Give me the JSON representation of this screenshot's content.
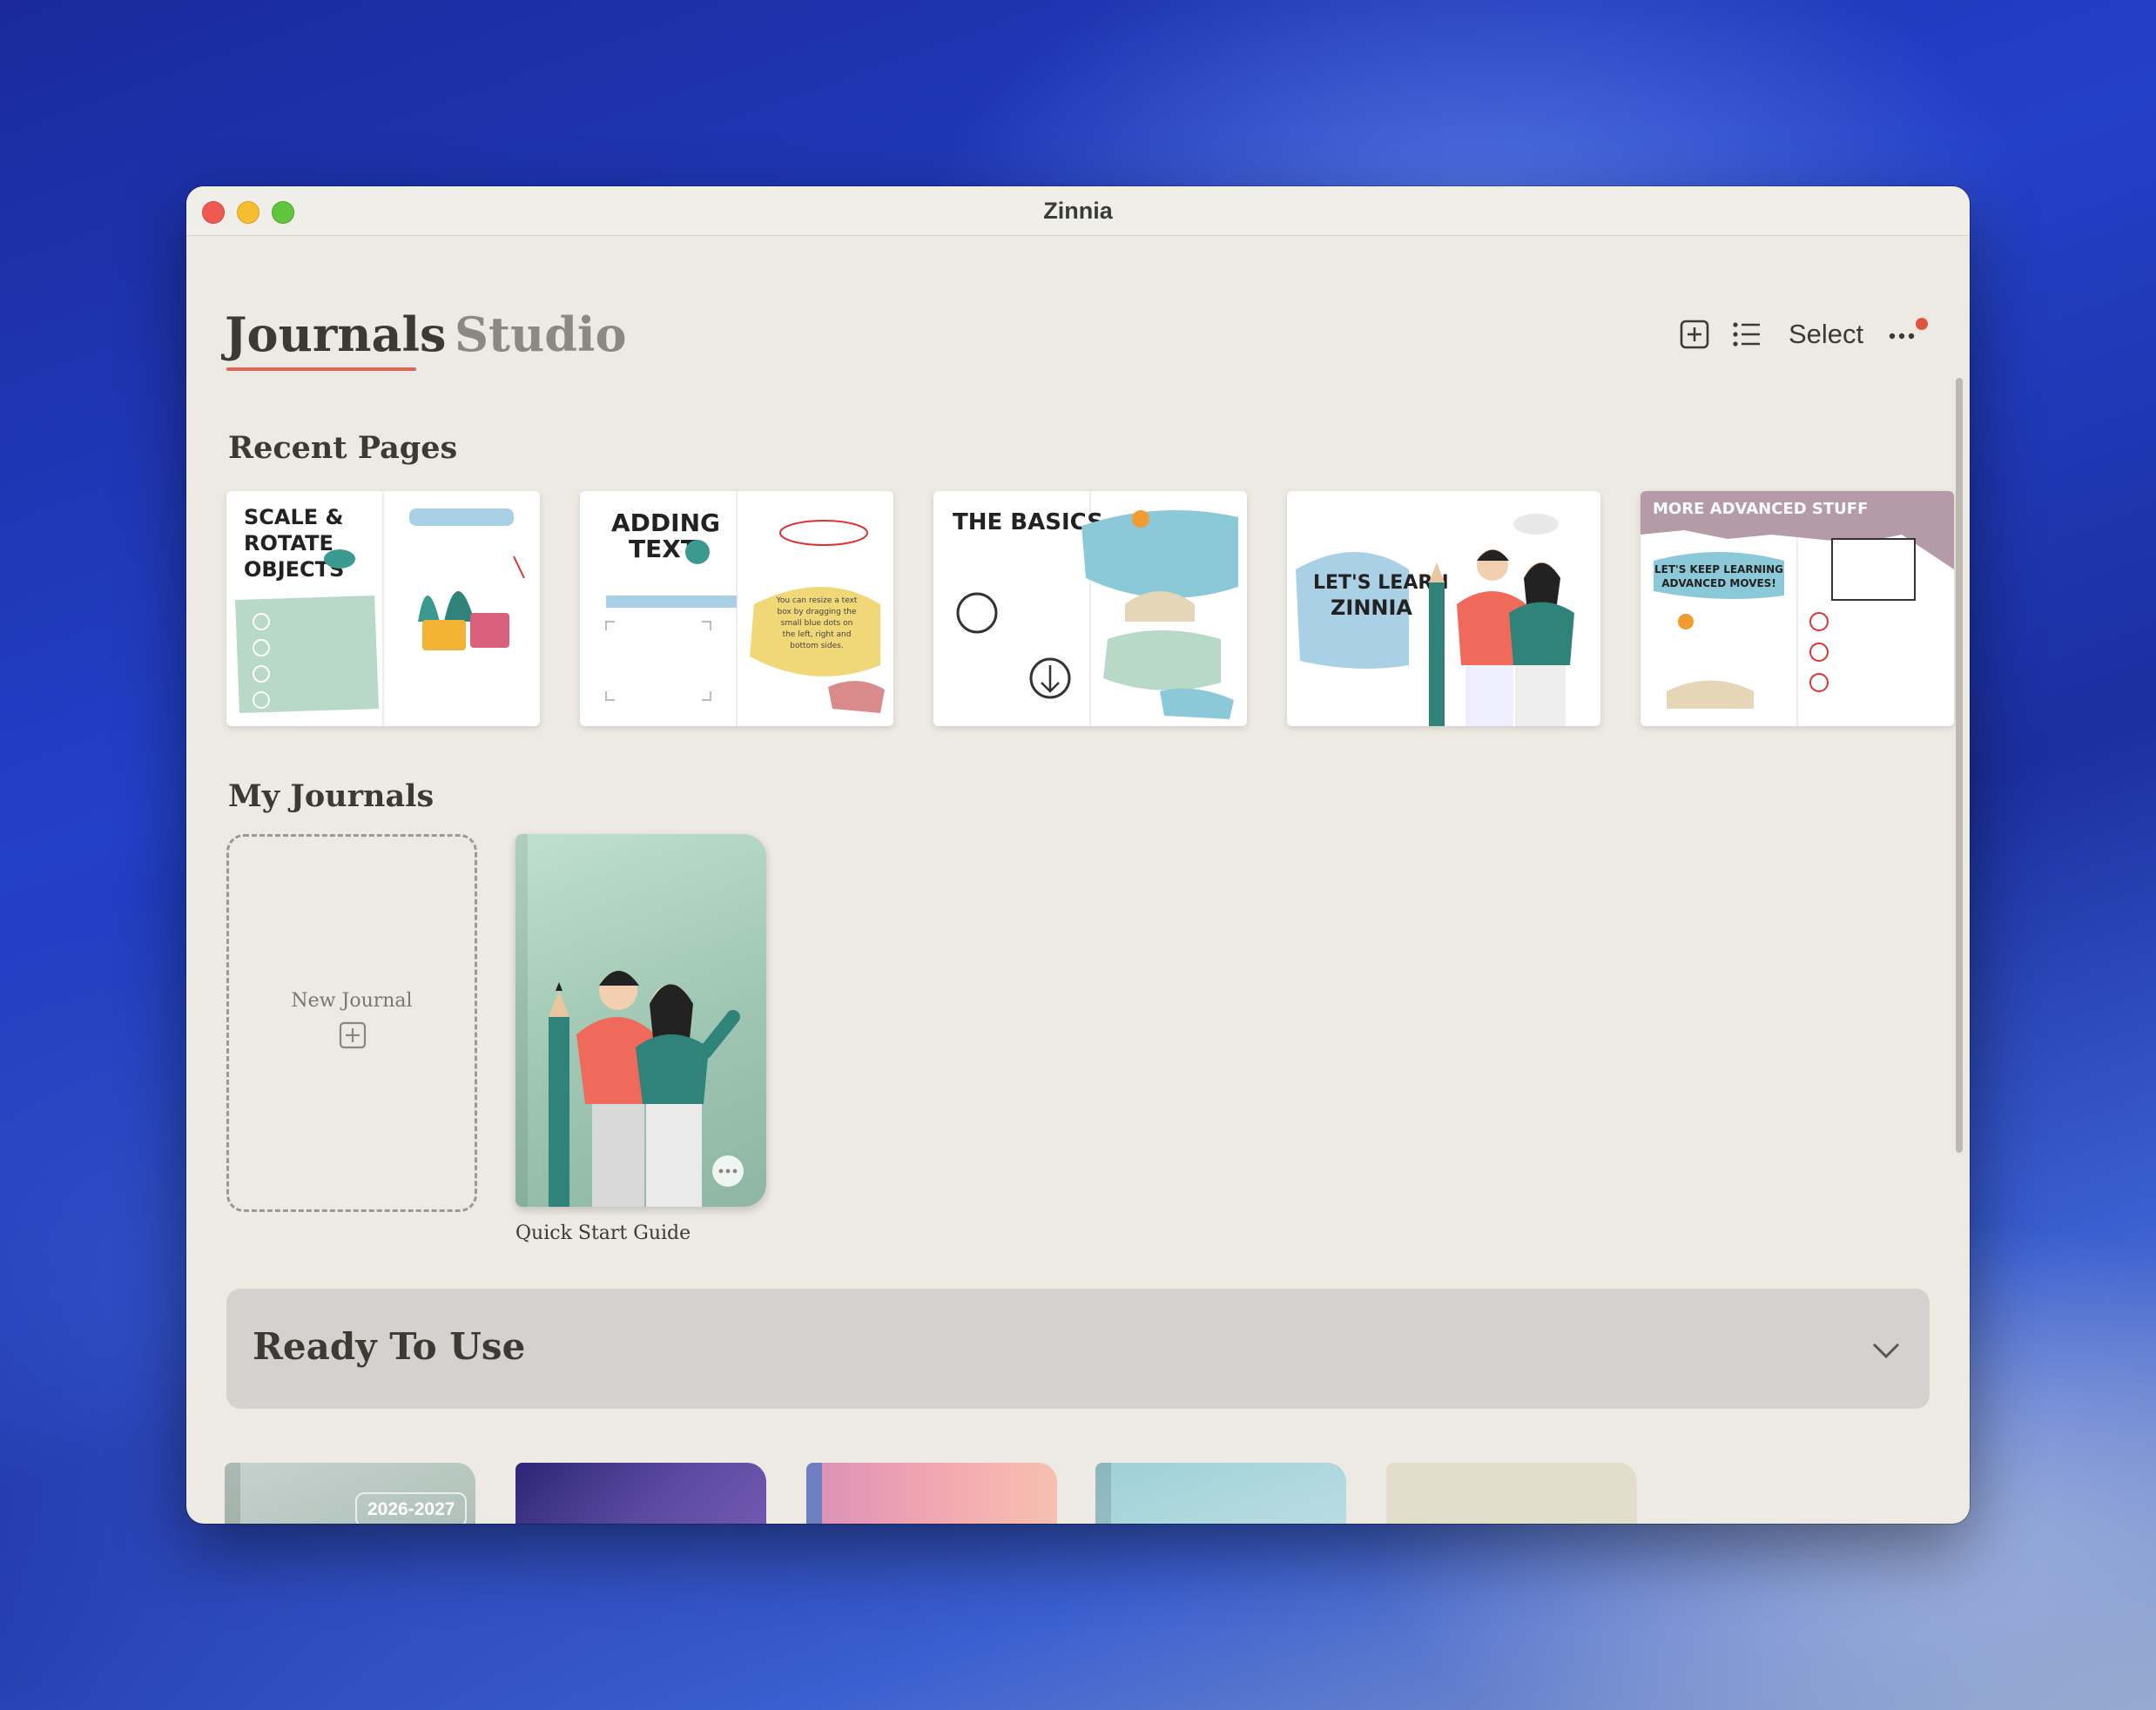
{
  "app": {
    "title": "Zinnia"
  },
  "tabs": [
    {
      "label": "Journals",
      "active": true
    },
    {
      "label": "Studio",
      "active": false
    }
  ],
  "toolbar": {
    "add_icon": "plus-square-icon",
    "list_icon": "list-icon",
    "select_label": "Select",
    "more_icon": "ellipsis-icon",
    "notification_color": "#e0553f"
  },
  "recent_pages": {
    "title": "Recent Pages",
    "items": [
      {
        "name": "SCALE & ROTATE OBJECTS",
        "heading": [
          "SCALE &",
          "ROTATE",
          "OBJECTS"
        ]
      },
      {
        "name": "ADDING TEXT",
        "heading": [
          "ADDING",
          "TEXT"
        ],
        "bubble": [
          "You can resize a text",
          "box by dragging the",
          "small blue dots on",
          "the left, right and",
          "bottom sides."
        ]
      },
      {
        "name": "THE BASICS",
        "heading": [
          "THE BASICS"
        ]
      },
      {
        "name": "LET'S LEARN ZINNIA",
        "heading": [
          "LET'S LEARN",
          "ZINNIA"
        ]
      },
      {
        "name": "MORE ADVANCED STUFF",
        "heading": [
          "MORE ADVANCED STUFF"
        ],
        "sub": [
          "LET'S KEEP LEARNING",
          "ADVANCED MOVES!"
        ]
      }
    ]
  },
  "my_journals": {
    "title": "My Journals",
    "new_journal_label": "New Journal",
    "journals": [
      {
        "title": "Quick Start Guide"
      }
    ]
  },
  "ready_to_use": {
    "title": "Ready To Use",
    "templates": [
      {
        "color": "#b8c9c2",
        "badge": "2026-2027"
      },
      {
        "color": "#4b3c8f",
        "badge": ""
      },
      {
        "color": "#e8a0b2",
        "badge": ""
      },
      {
        "color": "#a9d3dc",
        "badge": ""
      },
      {
        "color": "#e3ddcb",
        "badge": ""
      }
    ]
  },
  "colors": {
    "accent": "#d96a5a",
    "background": "#edeae4"
  }
}
